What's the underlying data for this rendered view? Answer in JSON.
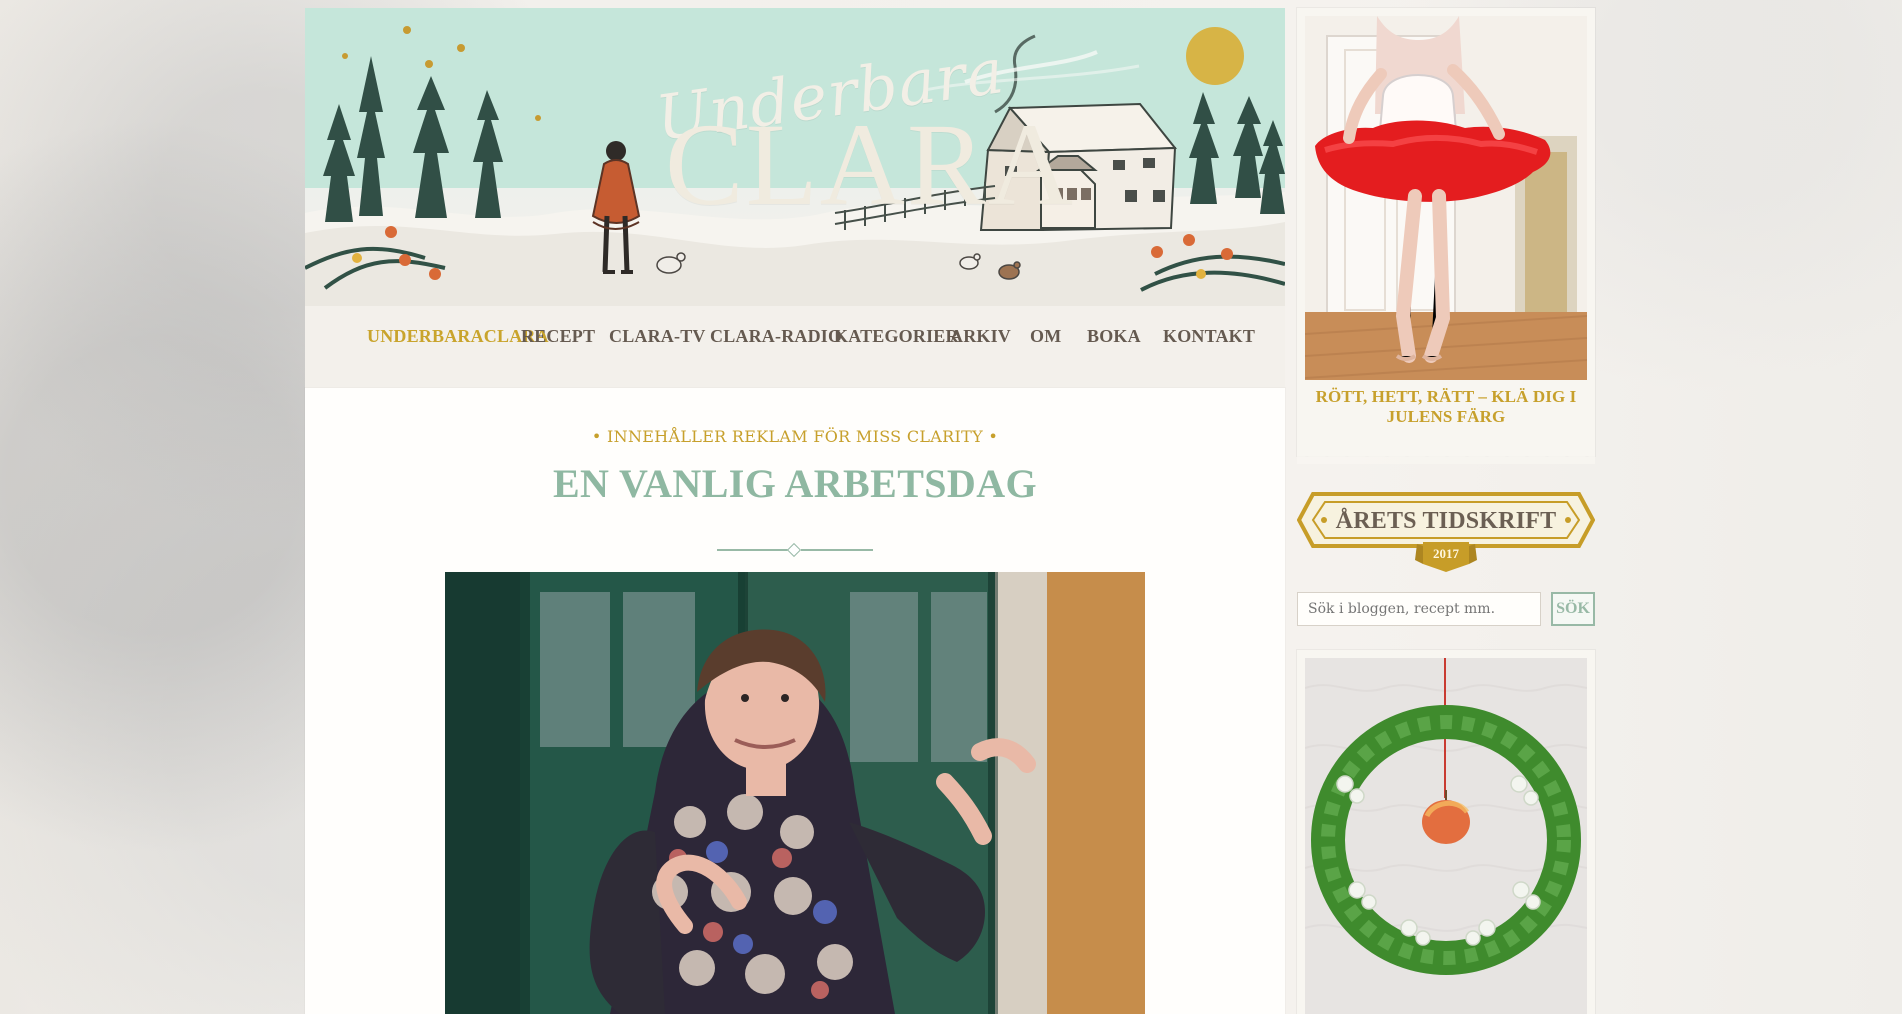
{
  "site": {
    "brand_top": "Underbara",
    "brand_bottom": "CLARA"
  },
  "navigation": {
    "items": [
      {
        "label": "UNDERBARACLARA",
        "active": true
      },
      {
        "label": "RECEPT",
        "active": false
      },
      {
        "label": "CLARA-TV",
        "active": false
      },
      {
        "label": "CLARA-RADIO",
        "active": false
      },
      {
        "label": "KATEGORIER",
        "active": false
      },
      {
        "label": "ARKIV",
        "active": false
      },
      {
        "label": "OM",
        "active": false
      },
      {
        "label": "BOKA",
        "active": false
      },
      {
        "label": "KONTAKT",
        "active": false
      }
    ]
  },
  "post": {
    "sponsor": "• INNEHÅLLER REKLAM FÖR MISS CLARITY •",
    "title": "EN VANLIG ARBETSDAG"
  },
  "sidebar": {
    "feature_caption": "RÖTT, HETT, RÄTT – KLÄ DIG I JULENS FÄRG",
    "award_title": "ÅRETS TIDSKRIFT",
    "award_year": "2017",
    "search_placeholder": "Sök i bloggen, recept mm.",
    "search_button": "SÖK"
  },
  "colors": {
    "accent_gold": "#c9a42c",
    "accent_green": "#8fb8a2",
    "nav_text": "#655a50"
  },
  "icons": {
    "header": "winter-illustration",
    "award": "ribbon-icon",
    "divider": "diamond-divider-icon"
  }
}
